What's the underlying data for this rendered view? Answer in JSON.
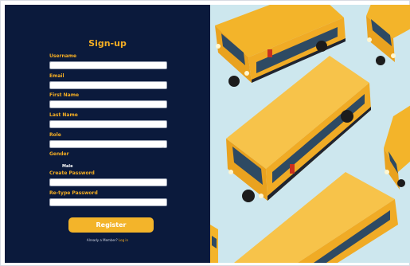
{
  "form": {
    "title": "Sign-up",
    "username_label": "Username",
    "username_value": "",
    "email_label": "Email",
    "email_value": "",
    "first_name_label": "First Name",
    "first_name_value": "",
    "last_name_label": "Last Name",
    "last_name_value": "",
    "role_label": "Role",
    "role_value": "",
    "gender_label": "Gender",
    "gender_value": "Male",
    "create_password_label": "Create Password",
    "create_password_value": "",
    "retype_password_label": "Re-type Password",
    "retype_password_value": "",
    "register_label": "Register",
    "footer_text": "Already a Member?",
    "login_link": "Log in"
  },
  "image": {
    "subject": "school-buses-photo",
    "colors": {
      "background": "#cde7ee",
      "bus_body": "#f3b42a",
      "bus_roof": "#f7c34a",
      "window": "#2e4a63",
      "stripe": "#1f2430",
      "wheel": "#1c1c1c"
    }
  },
  "colors": {
    "panel": "#0b1a3c",
    "accent": "#f3ad24",
    "button": "#f3b42a"
  }
}
